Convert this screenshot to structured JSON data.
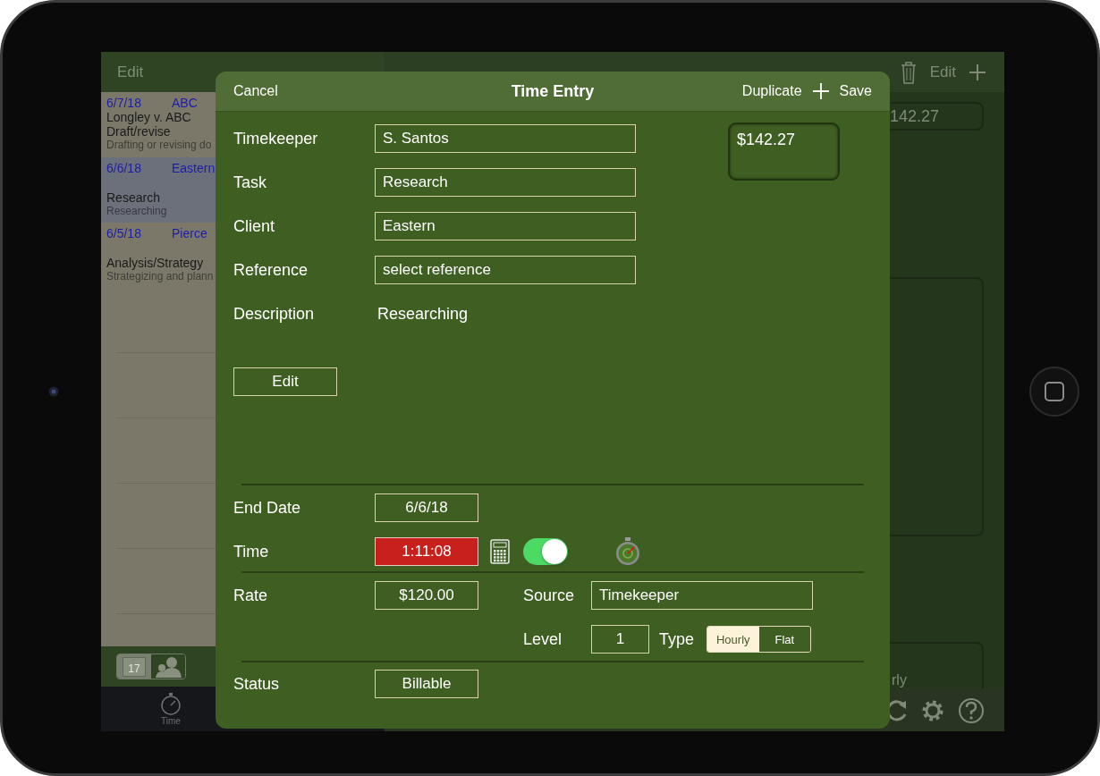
{
  "master": {
    "edit": "Edit",
    "entries": [
      {
        "date": "6/7/18",
        "client": "ABC",
        "title": "Longley v. ABC",
        "task": "Draft/revise",
        "note": "Drafting or revising do",
        "selected": false
      },
      {
        "date": "6/6/18",
        "client": "Eastern",
        "task": "Research",
        "note": "Researching",
        "selected": true
      },
      {
        "date": "6/5/18",
        "client": "Pierce",
        "task": "Analysis/Strategy",
        "note": "Strategizing and plann",
        "selected": false
      }
    ],
    "view_toggle": [
      {
        "label": "17",
        "selected": false
      },
      {
        "selected": true
      }
    ],
    "tab": {
      "label": "Time"
    }
  },
  "detail": {
    "edit": "Edit",
    "amount": "142.27",
    "footer_text": "rly"
  },
  "modal": {
    "cancel": "Cancel",
    "title": "Time Entry",
    "duplicate": "Duplicate",
    "save": "Save",
    "fields": [
      {
        "label": "Timekeeper",
        "value": "S. Santos"
      },
      {
        "label": "Task",
        "value": "Research"
      },
      {
        "label": "Client",
        "value": "Eastern"
      },
      {
        "label": "Reference",
        "value": "select reference"
      }
    ],
    "amount": "$142.27",
    "description": {
      "label": "Description",
      "text": "Researching"
    },
    "edit_button": "Edit",
    "end_date": {
      "label": "End Date",
      "value": "6/6/18"
    },
    "time": {
      "label": "Time",
      "value": "1:11:08",
      "running": true,
      "toggle_on": true
    },
    "rate": {
      "label": "Rate",
      "value": "$120.00"
    },
    "source": {
      "label": "Source",
      "value": "Timekeeper"
    },
    "level": {
      "label": "Level",
      "value": "1"
    },
    "type": {
      "label": "Type",
      "options": [
        {
          "label": "Hourly",
          "selected": true
        },
        {
          "label": "Flat",
          "selected": false
        }
      ]
    },
    "status": {
      "label": "Status",
      "value": "Billable"
    }
  }
}
